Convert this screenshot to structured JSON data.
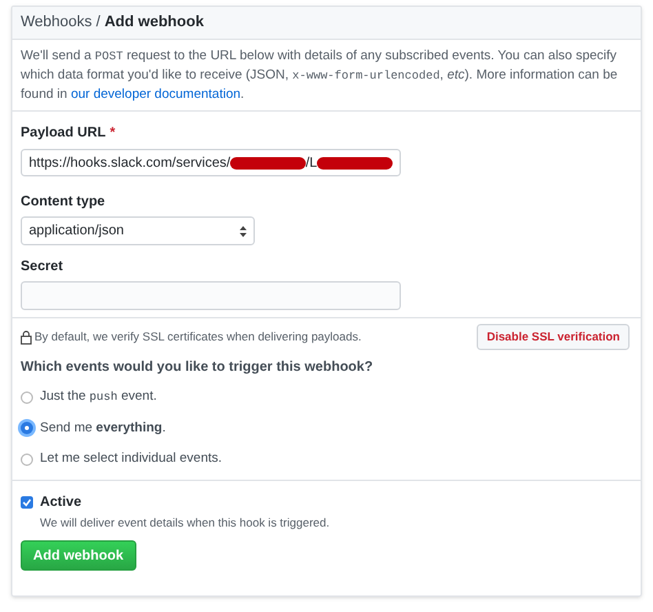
{
  "breadcrumb": {
    "parent": "Webhooks",
    "separator": "/",
    "current": "Add webhook"
  },
  "description": [
    {
      "kind": "text",
      "text": "We'll send a "
    },
    {
      "kind": "code",
      "text": "POST"
    },
    {
      "kind": "text",
      "text": " request to the URL below with details of any subscribed events. You can also specify which data format you'd like to receive (JSON, "
    },
    {
      "kind": "code",
      "text": "x-www-form-urlencoded"
    },
    {
      "kind": "text",
      "text": ", "
    },
    {
      "kind": "italic",
      "text": "etc"
    },
    {
      "kind": "text",
      "text": "). More information can be found in "
    },
    {
      "kind": "link",
      "text": "our developer documentation"
    },
    {
      "kind": "text",
      "text": "."
    }
  ],
  "payload_url": {
    "label": "Payload URL",
    "required_mark": "*",
    "value": [
      {
        "kind": "text",
        "text": "https://hooks.slack.com/services/"
      },
      {
        "kind": "redacted"
      },
      {
        "kind": "text",
        "text": "/L"
      },
      {
        "kind": "redacted"
      }
    ]
  },
  "content_type": {
    "label": "Content type",
    "value": "application/json"
  },
  "secret": {
    "label": "Secret"
  },
  "ssl": {
    "note": "By default, we verify SSL certificates when delivering payloads.",
    "button": "Disable SSL verification"
  },
  "events": {
    "question": "Which events would you like to trigger this webhook?",
    "options": [
      {
        "selected": false,
        "label": [
          {
            "kind": "text",
            "text": "Just the "
          },
          {
            "kind": "code",
            "text": "push"
          },
          {
            "kind": "text",
            "text": " event."
          }
        ]
      },
      {
        "selected": true,
        "label": [
          {
            "kind": "text",
            "text": "Send me "
          },
          {
            "kind": "bold",
            "text": "everything"
          },
          {
            "kind": "text",
            "text": "."
          }
        ]
      },
      {
        "selected": false,
        "label": [
          {
            "kind": "text",
            "text": "Let me select individual events."
          }
        ]
      }
    ]
  },
  "active": {
    "checked": true,
    "label": "Active",
    "note": "We will deliver event details when this hook is triggered."
  },
  "submit": "Add webhook"
}
